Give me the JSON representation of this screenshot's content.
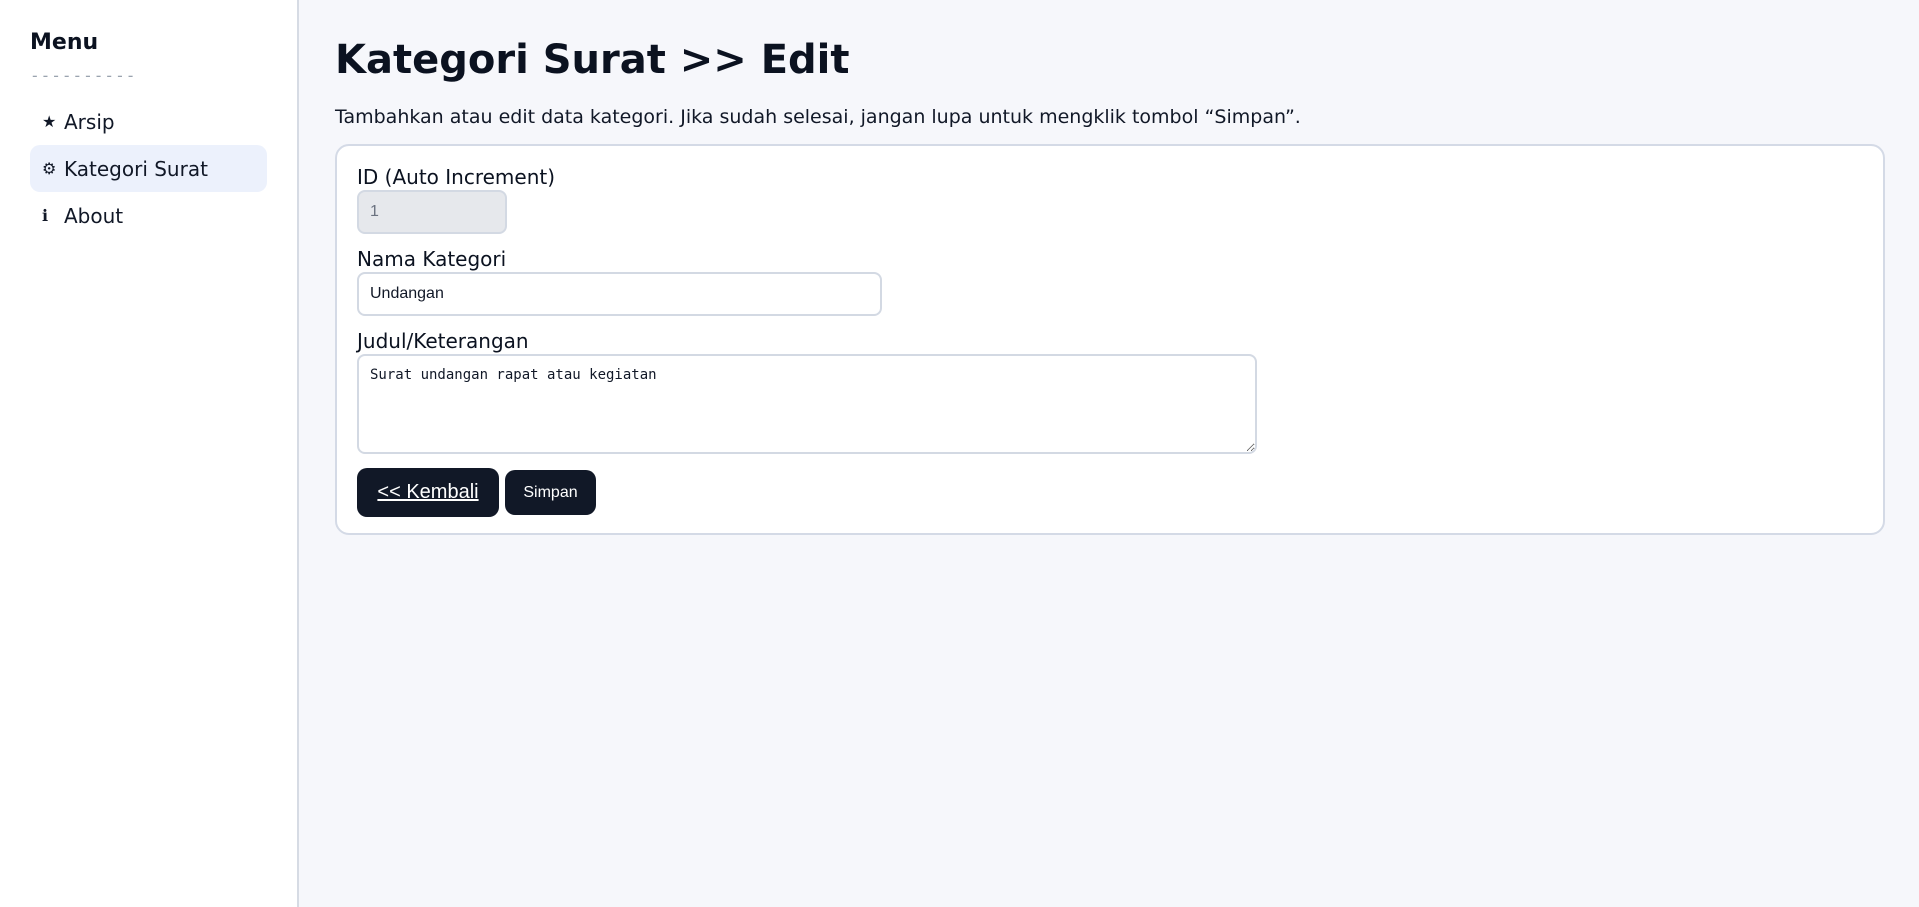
{
  "sidebar": {
    "title": "Menu",
    "divider": "----------",
    "items": [
      {
        "icon": "★",
        "icon_name": "star-icon",
        "label": "Arsip",
        "active": false
      },
      {
        "icon": "⚙",
        "icon_name": "gear-icon",
        "label": "Kategori Surat",
        "active": true
      },
      {
        "icon": "ℹ",
        "icon_name": "info-icon",
        "label": "About",
        "active": false
      }
    ]
  },
  "main": {
    "title": "Kategori Surat >> Edit",
    "description": "Tambahkan atau edit data kategori. Jika sudah selesai, jangan lupa untuk mengklik tombol “Simpan”."
  },
  "form": {
    "id_label": "ID (Auto Increment)",
    "id_value": "1",
    "name_label": "Nama Kategori",
    "name_value": "Undangan",
    "desc_label": "Judul/Keterangan",
    "desc_value": "Surat undangan rapat atau kegiatan",
    "back_label": "<< Kembali",
    "save_label": "Simpan"
  },
  "colors": {
    "sidebar_active_bg": "#ecf1fc",
    "button_bg": "#111827",
    "page_bg": "#f6f7fb"
  }
}
